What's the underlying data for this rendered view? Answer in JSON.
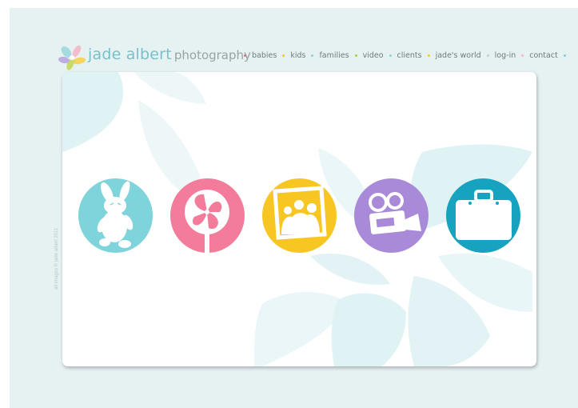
{
  "brand": {
    "name": "jade albert",
    "suffix": "photography"
  },
  "nav": {
    "items": [
      {
        "label": "babies",
        "dot_color": "#e56b8c"
      },
      {
        "label": "kids",
        "dot_color": "#f2c53a"
      },
      {
        "label": "families",
        "dot_color": "#8fd3d9"
      },
      {
        "label": "video",
        "dot_color": "#b6c939"
      },
      {
        "label": "clients",
        "dot_color": "#8fd3d9"
      },
      {
        "label": "jade's world",
        "dot_color": "#f2c53a"
      },
      {
        "label": "log-in",
        "dot_color": "#c9cfd1"
      },
      {
        "label": "contact",
        "dot_color": "#f3b7c8"
      }
    ],
    "trailing_dot_color": "#7fd0dc"
  },
  "categories": [
    {
      "name": "babies",
      "icon": "bunny-icon",
      "color": "#7fd4dc"
    },
    {
      "name": "kids",
      "icon": "lollipop-icon",
      "color": "#f27c99"
    },
    {
      "name": "families",
      "icon": "family-photo-icon",
      "color": "#f7c623"
    },
    {
      "name": "video",
      "icon": "video-camera-icon",
      "color": "#a98ad8"
    },
    {
      "name": "clients",
      "icon": "briefcase-icon",
      "color": "#17a3bf"
    }
  ],
  "colors": {
    "page_bg": "#e6f1f2",
    "leaf": "#d3eff1",
    "brand": "#7bbfc8"
  },
  "footer": {
    "credit": "all images © jade albert 2011"
  }
}
